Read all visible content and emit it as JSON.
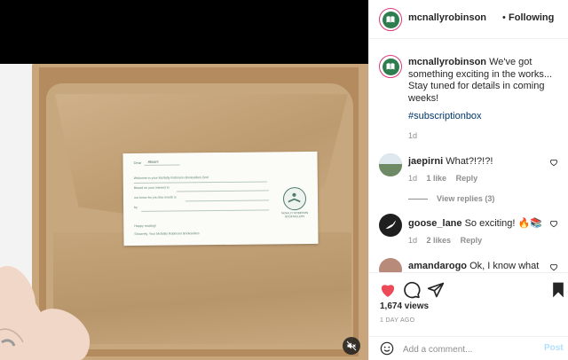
{
  "post": {
    "username": "mcnallyrobinson",
    "follow_status": "Following",
    "separator": "•",
    "caption_text": "We've got something exciting in the works... Stay tuned for details in coming weeks!",
    "hashtag": "#subscriptionbox",
    "caption_age": "1d"
  },
  "media": {
    "card": {
      "dear": "Dear",
      "name": "Alison!",
      "line1": "Welcome to your McNally Robinson Booksellers Box!",
      "line2": "Based on your interest in",
      "line3": "our know for you this month is",
      "line4": "by",
      "closing": "Happy reading!",
      "signoff": "Sincerely, Your McNally Robinson Booksellers",
      "brand": "McNALLY ROBINSON BOOKSELLERS"
    },
    "mute_icon": "speaker-muted-icon"
  },
  "comments": [
    {
      "username": "jaepirni",
      "text": "What?!?!?!",
      "age": "1d",
      "likes": "1 like",
      "reply": "Reply",
      "avatar_color": "#8fa28a"
    },
    {
      "username": "goose_lane",
      "text": "So exciting! 🔥📚",
      "age": "1d",
      "likes": "2 likes",
      "reply": "Reply",
      "avatar_color": "#1f1f1f"
    },
    {
      "username": "amandarogo",
      "text": "Ok, I know what",
      "age": "",
      "likes": "",
      "reply": "",
      "avatar_color": "#b88a7a"
    }
  ],
  "view_replies": "View replies (3)",
  "actions": {
    "like_icon": "heart-filled-icon",
    "comment_icon": "comment-icon",
    "share_icon": "share-icon",
    "save_icon": "bookmark-filled-icon",
    "views": "1,674 views",
    "time_ago": "1 DAY AGO"
  },
  "add_comment": {
    "placeholder": "Add a comment...",
    "post_label": "Post",
    "emoji_icon": "smiley-icon"
  },
  "colors": {
    "like_red": "#ed4956",
    "link_blue": "#00376b",
    "post_disabled": "#b2dffc",
    "brand_green": "#2e7d4f"
  }
}
